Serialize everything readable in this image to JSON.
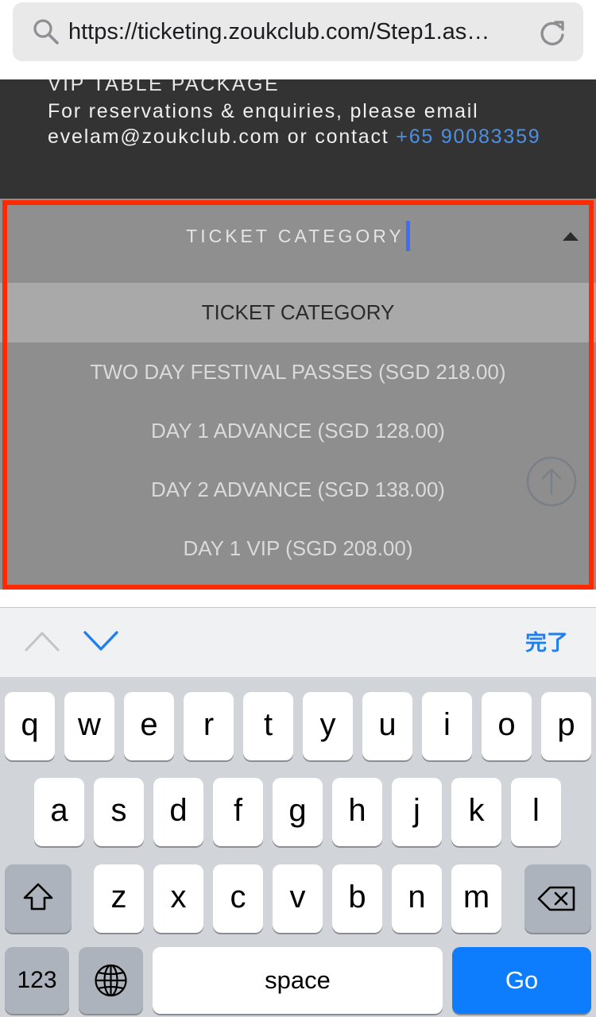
{
  "browser": {
    "url": "https://ticketing.zoukclub.com/Step1.as…",
    "search_icon": "search-icon",
    "reload_icon": "reload-icon"
  },
  "vip": {
    "title": "VIP TABLE PACKAGE",
    "line1": "For reservations & enquiries, please email",
    "line2_prefix": "evelam@zoukclub.com or contact ",
    "phone": "+65 90083359",
    "phone_color": "#4d8fe1"
  },
  "ticket_select": {
    "label": "TICKET CATEGORY",
    "options": [
      "TICKET CATEGORY",
      "TWO DAY FESTIVAL PASSES (SGD 218.00)",
      "DAY 1 ADVANCE (SGD 128.00)",
      "DAY 2 ADVANCE (SGD 138.00)",
      "DAY 1 VIP (SGD 208.00)"
    ],
    "selected_index": 0,
    "highlight_color": "#ff2a00"
  },
  "accessory": {
    "prev_icon": "chevron-up-icon",
    "next_icon": "chevron-down-icon",
    "done_label": "完了",
    "accent": "#1f7ff0"
  },
  "keyboard": {
    "row1": [
      "q",
      "w",
      "e",
      "r",
      "t",
      "y",
      "u",
      "i",
      "o",
      "p"
    ],
    "row2": [
      "a",
      "s",
      "d",
      "f",
      "g",
      "h",
      "j",
      "k",
      "l"
    ],
    "row3": [
      "z",
      "x",
      "c",
      "v",
      "b",
      "n",
      "m"
    ],
    "numbers_label": "123",
    "space_label": "space",
    "go_label": "Go",
    "go_color": "#0d7dfd"
  }
}
